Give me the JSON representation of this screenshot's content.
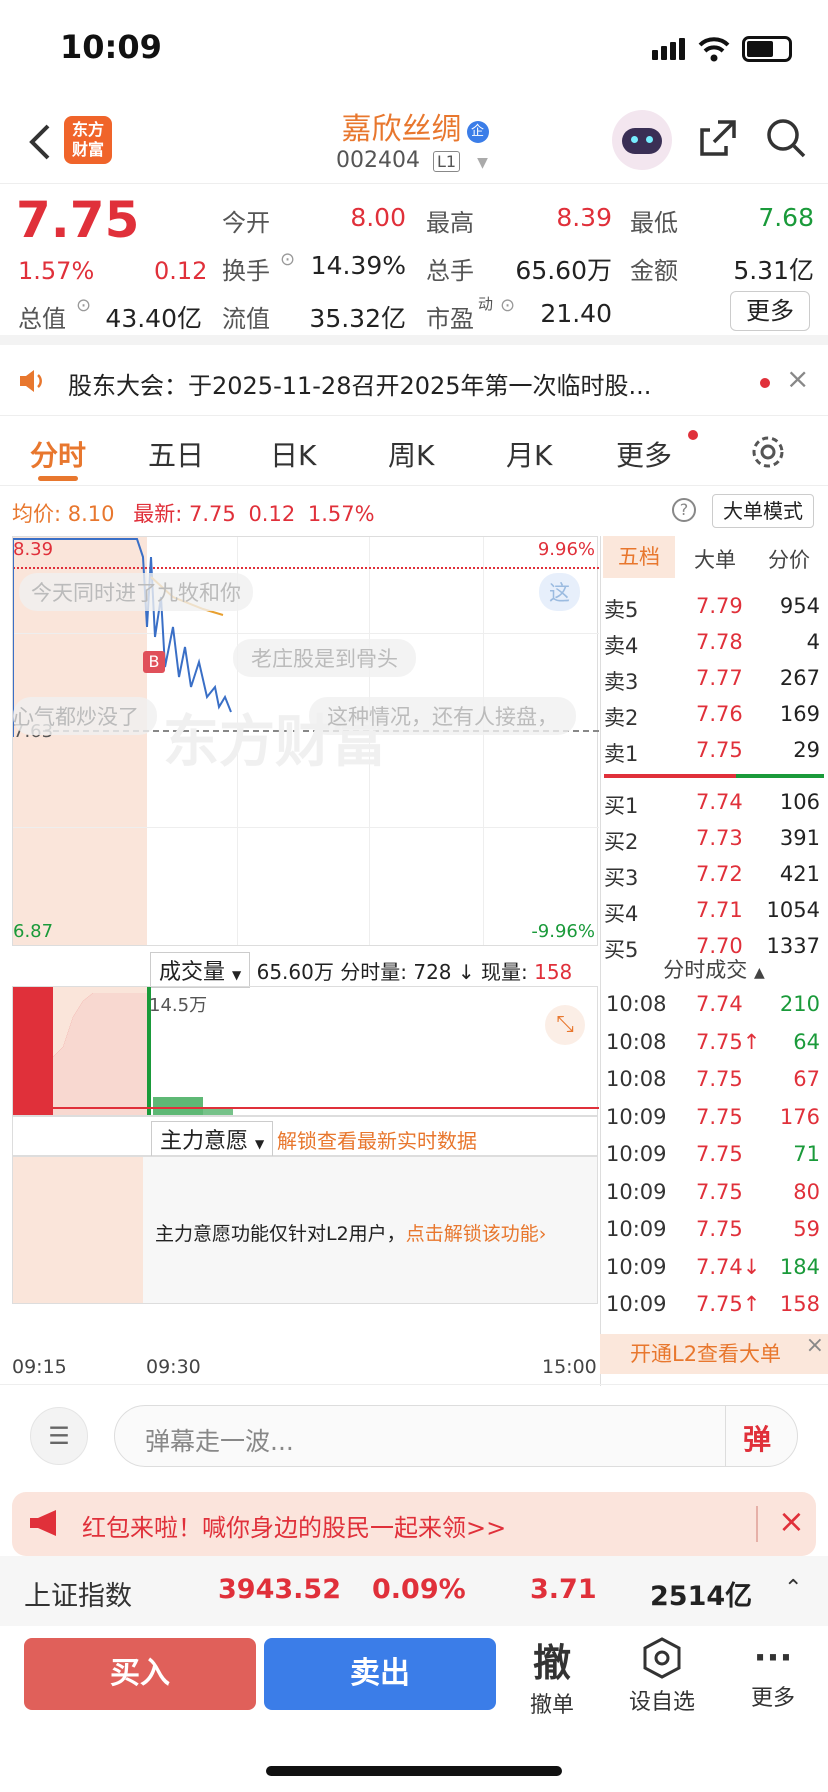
{
  "status": {
    "time": "10:09"
  },
  "header": {
    "title": "嘉欣丝绸",
    "code": "002404",
    "badge": "L1",
    "logo_line1": "东方",
    "logo_line2": "财富",
    "tag": "企"
  },
  "quote": {
    "price": "7.75",
    "pct": "1.57%",
    "chg": "0.12",
    "open_l": "今开",
    "open_v": "8.00",
    "high_l": "最高",
    "high_v": "8.39",
    "low_l": "最低",
    "low_v": "7.68",
    "turn_l": "换手",
    "turn_v": "14.39%",
    "vol_l": "总手",
    "vol_v": "65.60万",
    "amt_l": "金额",
    "amt_v": "5.31亿",
    "mcap_l": "总值",
    "mcap_v": "43.40亿",
    "float_l": "流值",
    "float_v": "35.32亿",
    "pe_l": "市盈",
    "pe_sup": "动",
    "pe_v": "21.40",
    "more": "更多"
  },
  "notice": {
    "text": "股东大会：于2025-11-28召开2025年第一次临时股..."
  },
  "tabs": [
    "分时",
    "五日",
    "日K",
    "周K",
    "月K",
    "更多"
  ],
  "chart": {
    "avg_label": "均价:",
    "avg_v": "8.10",
    "last_label": "最新:",
    "last_v": "7.75",
    "last_chg": "0.12",
    "last_pct": "1.57%",
    "mode_btn": "大单模式",
    "y_top": "8.39",
    "y_top_pct": "9.96%",
    "y_mid": "7.63",
    "y_bot": "6.87",
    "y_bot_pct": "-9.96%",
    "danmu": [
      "今天同时进了九牧和你",
      "老庄股是到骨头",
      "心气都炒没了",
      "这种情况，还有人接盘，",
      "这"
    ],
    "watermark": "东方财富",
    "b_marker": "B",
    "vol_select": "成交量",
    "vol_total": "65.60万",
    "vol_period_l": "分时量:",
    "vol_period_v": "728 ↓",
    "vol_now_l": "现量:",
    "vol_now_v": "158",
    "vol_max": "14.5万",
    "main_select": "主力意愿",
    "unlock": "解锁查看最新实时数据",
    "l2_note": "主力意愿功能仅针对L2用户，",
    "l2_link": "点击解锁该功能",
    "t_start": "09:15",
    "t_open": "09:30",
    "t_end": "15:00"
  },
  "orderbook": {
    "tabs": [
      "五档",
      "大单",
      "分价"
    ],
    "asks": [
      {
        "l": "卖5",
        "p": "7.79",
        "v": "954"
      },
      {
        "l": "卖4",
        "p": "7.78",
        "v": "4"
      },
      {
        "l": "卖3",
        "p": "7.77",
        "v": "267"
      },
      {
        "l": "卖2",
        "p": "7.76",
        "v": "169"
      },
      {
        "l": "卖1",
        "p": "7.75",
        "v": "29"
      }
    ],
    "bids": [
      {
        "l": "买1",
        "p": "7.74",
        "v": "106"
      },
      {
        "l": "买2",
        "p": "7.73",
        "v": "391"
      },
      {
        "l": "买3",
        "p": "7.72",
        "v": "421"
      },
      {
        "l": "买4",
        "p": "7.71",
        "v": "1054"
      },
      {
        "l": "买5",
        "p": "7.70",
        "v": "1337"
      }
    ],
    "trades_title": "分时成交",
    "trades": [
      {
        "t": "10:08",
        "p": "7.74",
        "v": "210",
        "c": "green",
        "pc": "red"
      },
      {
        "t": "10:08",
        "p": "7.75↑",
        "v": "64",
        "c": "green",
        "pc": "red"
      },
      {
        "t": "10:08",
        "p": "7.75",
        "v": "67",
        "c": "red",
        "pc": "red"
      },
      {
        "t": "10:09",
        "p": "7.75",
        "v": "176",
        "c": "red",
        "pc": "red"
      },
      {
        "t": "10:09",
        "p": "7.75",
        "v": "71",
        "c": "green",
        "pc": "red"
      },
      {
        "t": "10:09",
        "p": "7.75",
        "v": "80",
        "c": "red",
        "pc": "red"
      },
      {
        "t": "10:09",
        "p": "7.75",
        "v": "59",
        "c": "red",
        "pc": "red"
      },
      {
        "t": "10:09",
        "p": "7.74↓",
        "v": "184",
        "c": "green",
        "pc": "red"
      },
      {
        "t": "10:09",
        "p": "7.75↑",
        "v": "158",
        "c": "red",
        "pc": "red"
      }
    ],
    "l2_banner": "开通L2查看大单"
  },
  "comment": {
    "placeholder": "弹幕走一波...",
    "send": "弹"
  },
  "promo": {
    "text": "红包来啦！喊你身边的股民一起来领>>"
  },
  "index": {
    "name": "上证指数",
    "price": "3943.52",
    "pct": "0.09%",
    "chg": "3.71",
    "amt": "2514亿"
  },
  "actions": {
    "buy": "买入",
    "sell": "卖出",
    "cancel_big": "撤",
    "cancel": "撤单",
    "watch": "设自选",
    "more": "更多"
  },
  "colors": {
    "up": "#e0303a",
    "down": "#1a9a3a",
    "accent": "#e8772e",
    "buy": "#e0605a",
    "sell": "#3b7de8"
  }
}
